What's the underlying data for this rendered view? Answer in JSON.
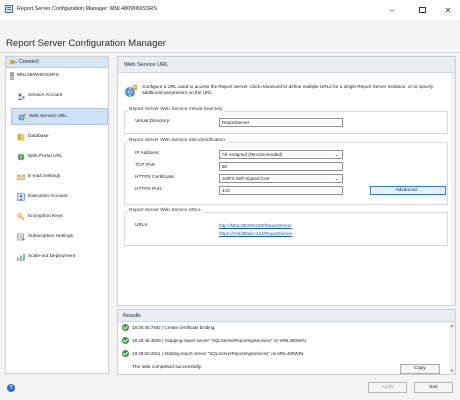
{
  "window": {
    "title": "Report Server Configuration Manager: MNL480WIN\\SSRS"
  },
  "app_header": {
    "title": "Report Server Configuration Manager"
  },
  "sidebar": {
    "connect_label": "Connect",
    "server_label": "MNL480WIN\\SSRS",
    "items": [
      {
        "label": "Service Account",
        "icon": "service-account-icon"
      },
      {
        "label": "Web Service URL",
        "icon": "web-service-icon",
        "selected": true
      },
      {
        "label": "Database",
        "icon": "database-icon"
      },
      {
        "label": "Web Portal URL",
        "icon": "globe-icon"
      },
      {
        "label": "E-mail Settings",
        "icon": "email-icon"
      },
      {
        "label": "Execution Account",
        "icon": "execution-account-icon"
      },
      {
        "label": "Encryption Keys",
        "icon": "key-icon"
      },
      {
        "label": "Subscription Settings",
        "icon": "subscription-icon"
      },
      {
        "label": "Scale-out Deployment",
        "icon": "scale-out-icon"
      }
    ]
  },
  "main": {
    "title": "Web Service URL",
    "intro": "Configure a URL used to access the Report Server. Click Advanced to define multiple URLs for a single Report Server instance, or to specify additional parameters on the URL.",
    "virtual_directory": {
      "group_title": "Report Server Web Service Virtual Directory",
      "label": "Virtual Directory:",
      "value": "ReportServer"
    },
    "site_identification": {
      "group_title": "Report Server Web Service Site identification",
      "ip_label": "IP Address:",
      "ip_value": "All Assigned (Recommended)",
      "tcp_label": "TCP Port:",
      "tcp_value": "80",
      "https_cert_label": "HTTPS Certificate:",
      "https_cert_value": "SSRS Self-Signed Cert",
      "https_port_label": "HTTPS Port:",
      "https_port_value": "443",
      "advanced_label": "Advanced..."
    },
    "urls": {
      "group_title": "Report Server Web Service URLs",
      "label": "URLs:",
      "links": [
        "http://MNL480WIN:80/ReportServer",
        "https://mnl480win:443/ReportServer"
      ]
    }
  },
  "results": {
    "title": "Results",
    "rows": [
      "18:48:48.7592 | Create certificate binding.",
      "18:48:49.3529 | Stopping report server \"SQLServerReportingServices\" on MNL480WIN.",
      "18:48:50.2911 | Starting report server \"SQLServerReportingServices\" on MNL480WIN."
    ],
    "completed": "The task completed successfully.",
    "copy_label": "Copy"
  },
  "footer": {
    "apply_label": "Apply",
    "exit_label": "Exit"
  },
  "colors": {
    "accent": "#1657c9",
    "selection": "#cfe1f4",
    "success": "#3a9a3a"
  }
}
